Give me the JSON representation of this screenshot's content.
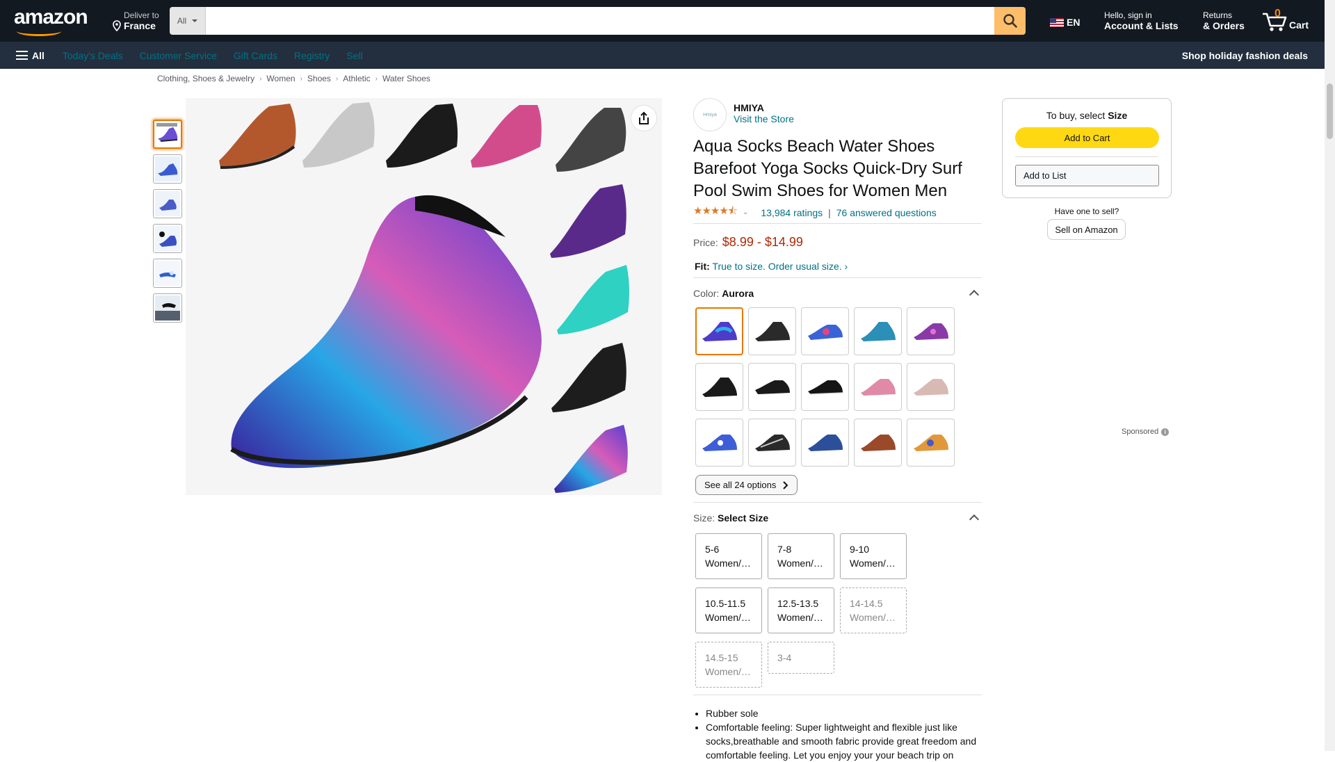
{
  "header": {
    "deliver_line1": "Deliver to",
    "deliver_line2": "France",
    "search_category": "All",
    "search_placeholder": "",
    "language": "EN",
    "account_line1": "Hello, sign in",
    "account_line2": "Account & Lists",
    "returns_line1": "Returns",
    "returns_line2": "& Orders",
    "cart_count": "0",
    "cart_label": "Cart"
  },
  "subnav": {
    "all_label": "All",
    "items": [
      "Today's Deals",
      "Customer Service",
      "Gift Cards",
      "Registry",
      "Sell"
    ],
    "promo": "Shop holiday fashion deals"
  },
  "breadcrumb": [
    "Clothing, Shoes & Jewelry",
    "Women",
    "Shoes",
    "Athletic",
    "Water Shoes"
  ],
  "product": {
    "brand": "HMIYA",
    "brand_logo_text": "Hmiya",
    "visit_store": "Visit the Store",
    "title": "Aqua Socks Beach Water Shoes Barefoot Yoga Socks Quick-Dry Surf Pool Swim Shoes for Women Men",
    "ratings": "13,984 ratings",
    "separator": "|",
    "questions": "76 answered questions",
    "price_label": "Price:",
    "price": "$8.99 - $14.99",
    "fit_label": "Fit:",
    "fit_text": "True to size. Order usual size.",
    "fit_arrow": "›",
    "color_label": "Color:",
    "color_value": "Aurora",
    "see_all": "See all 24 options",
    "size_label": "Size:",
    "size_value": "Select Size",
    "sizes": [
      {
        "label": "5-6 Women/…",
        "available": true
      },
      {
        "label": "7-8 Women/…",
        "available": true
      },
      {
        "label": "9-10 Women/…",
        "available": true
      },
      {
        "label": "10.5-11.5 Women/…",
        "available": true
      },
      {
        "label": "12.5-13.5 Women/…",
        "available": true
      },
      {
        "label": "14-14.5 Women/…",
        "available": false
      },
      {
        "label": "14.5-15 Women/…",
        "available": false
      },
      {
        "label": "3-4",
        "available": false
      }
    ],
    "bullets": [
      "Rubber sole",
      "Comfortable feeling: Super lightweight and flexible just like socks,breathable and smooth fabric provide great freedom and comfortable feeling. Let you enjoy your your beach trip on"
    ]
  },
  "buybox": {
    "hint_prefix": "To buy, select",
    "hint_bold": "Size",
    "add_to_cart": "Add to Cart",
    "add_to_list": "Add to List",
    "sell_question": "Have one to sell?",
    "sell_button": "Sell on Amazon",
    "sponsored": "Sponsored"
  },
  "colors": {
    "nav_bg": "#131921",
    "subnav_bg": "#232f3e",
    "search_button": "#febd69",
    "cart_button": "#ffd814",
    "price": "#b12704",
    "link": "#007185",
    "selected_border": "#e77600"
  }
}
